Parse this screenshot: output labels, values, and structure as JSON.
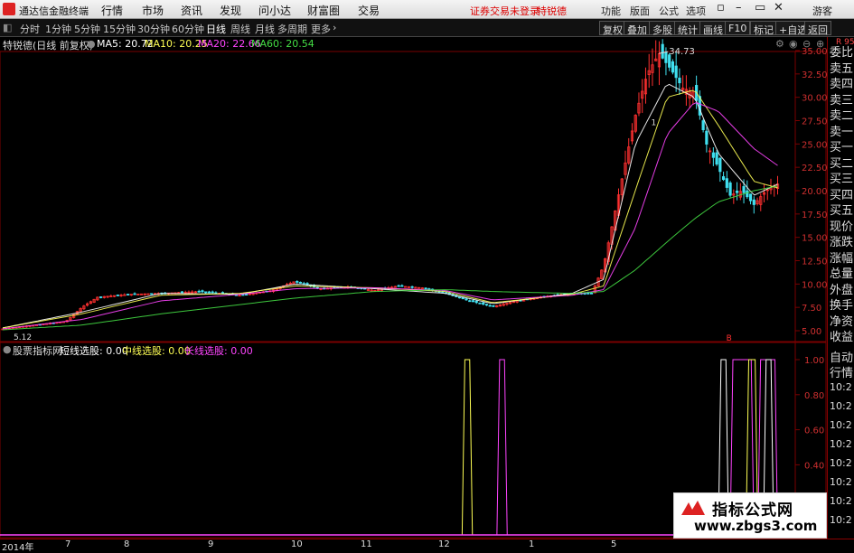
{
  "window": {
    "app_title": "通达信金融终端",
    "menu": [
      "行情",
      "市场",
      "资讯",
      "发现",
      "问小达",
      "财富圈",
      "交易"
    ],
    "status_notice": "证券交易未登录",
    "stock_name_title": "特锐德",
    "controls": [
      "功能",
      "版面",
      "公式",
      "选项"
    ],
    "guest": "游客"
  },
  "toolbar": {
    "periods": [
      "分时",
      "1分钟",
      "5分钟",
      "15分钟",
      "30分钟",
      "60分钟",
      "日线",
      "周线",
      "月线",
      "多周期",
      "更多"
    ],
    "active_period": "日线",
    "right_buttons": [
      "复权",
      "叠加",
      "多股",
      "统计",
      "画线",
      "F10",
      "标记",
      "+自选",
      "返回"
    ]
  },
  "main_chart": {
    "title": "特锐德(日线 前复权)",
    "ma": [
      {
        "label": "MA5: 20.72",
        "color": "#ffffff"
      },
      {
        "label": "MA10: 20.25",
        "color": "#ffff55"
      },
      {
        "label": "MA20: 22.66",
        "color": "#ff44ff"
      },
      {
        "label": "MA60: 20.54",
        "color": "#44dd44"
      }
    ],
    "high_label": "34.73",
    "low_label": "5.12",
    "marker_b": "B",
    "marker_1": "1"
  },
  "indicator": {
    "title": "股票指标网",
    "lines": [
      {
        "label": "短线选股: 0.00",
        "color": "#ffffff"
      },
      {
        "label": "中线选股: 0.00",
        "color": "#ffff55"
      },
      {
        "label": "长线选股: 0.00",
        "color": "#ff44ff"
      }
    ]
  },
  "side_panel": {
    "top_label": "R 95",
    "items": [
      "委比",
      "卖五",
      "卖四",
      "卖三",
      "卖二",
      "卖一",
      "买一",
      "买二",
      "买三",
      "买四",
      "买五",
      "现价",
      "涨跌",
      "涨幅",
      "总量",
      "外盘",
      "换手",
      "净资",
      "收益"
    ],
    "lower": [
      "自动",
      "行情"
    ],
    "times": [
      "10:2",
      "10:2",
      "10:2",
      "10:2",
      "10:2",
      "10:2",
      "10:2",
      "10:2"
    ]
  },
  "date_axis": {
    "labels": [
      "2014年",
      "7",
      "8",
      "9",
      "10",
      "11",
      "12",
      "1",
      "5"
    ]
  },
  "watermark": {
    "line1": "指标公式网",
    "line2": "www.zbgs3.com"
  },
  "chart_data": [
    {
      "type": "candlestick",
      "title": "特锐德(日线 前复权)",
      "ylim": [
        5.0,
        35.0
      ],
      "y_ticks": [
        35.0,
        32.5,
        30.0,
        27.5,
        25.0,
        22.5,
        20.0,
        17.5,
        15.0,
        12.5,
        10.0,
        7.5,
        5.0
      ],
      "ma_labels": [
        "MA5: 20.72",
        "MA10: 20.25",
        "MA20: 22.66",
        "MA60: 20.54"
      ],
      "price_path": [
        [
          0,
          5.2
        ],
        [
          0.04,
          5.6
        ],
        [
          0.08,
          6.0
        ],
        [
          0.1,
          7.5
        ],
        [
          0.12,
          8.6
        ],
        [
          0.16,
          8.9
        ],
        [
          0.2,
          9.0
        ],
        [
          0.25,
          9.2
        ],
        [
          0.3,
          8.8
        ],
        [
          0.34,
          9.3
        ],
        [
          0.37,
          10.3
        ],
        [
          0.4,
          9.5
        ],
        [
          0.44,
          9.7
        ],
        [
          0.47,
          9.3
        ],
        [
          0.5,
          9.8
        ],
        [
          0.53,
          9.6
        ],
        [
          0.56,
          9.0
        ],
        [
          0.59,
          8.2
        ],
        [
          0.62,
          7.6
        ],
        [
          0.65,
          8.2
        ],
        [
          0.68,
          8.6
        ],
        [
          0.72,
          9.0
        ],
        [
          0.745,
          9.0
        ],
        [
          0.76,
          12.0
        ],
        [
          0.78,
          20.0
        ],
        [
          0.8,
          28.0
        ],
        [
          0.815,
          32.5
        ],
        [
          0.83,
          34.7
        ],
        [
          0.845,
          33.0
        ],
        [
          0.86,
          31.0
        ],
        [
          0.875,
          30.5
        ],
        [
          0.89,
          25.0
        ],
        [
          0.905,
          22.5
        ],
        [
          0.92,
          19.5
        ],
        [
          0.935,
          20.0
        ],
        [
          0.95,
          18.5
        ],
        [
          0.965,
          20.0
        ],
        [
          0.98,
          20.7
        ]
      ],
      "ma5_path": [
        [
          0,
          5.3
        ],
        [
          0.1,
          7.0
        ],
        [
          0.2,
          9.0
        ],
        [
          0.3,
          8.9
        ],
        [
          0.37,
          10.0
        ],
        [
          0.47,
          9.5
        ],
        [
          0.56,
          9.0
        ],
        [
          0.62,
          7.9
        ],
        [
          0.72,
          9.0
        ],
        [
          0.76,
          10.5
        ],
        [
          0.8,
          25.0
        ],
        [
          0.84,
          31.5
        ],
        [
          0.875,
          30.0
        ],
        [
          0.905,
          24.0
        ],
        [
          0.95,
          19.5
        ],
        [
          0.98,
          20.7
        ]
      ],
      "ma10_path": [
        [
          0,
          5.3
        ],
        [
          0.1,
          6.8
        ],
        [
          0.2,
          8.8
        ],
        [
          0.3,
          9.0
        ],
        [
          0.37,
          9.8
        ],
        [
          0.47,
          9.6
        ],
        [
          0.56,
          9.2
        ],
        [
          0.62,
          8.0
        ],
        [
          0.72,
          8.9
        ],
        [
          0.76,
          9.8
        ],
        [
          0.8,
          20.0
        ],
        [
          0.84,
          30.0
        ],
        [
          0.875,
          30.8
        ],
        [
          0.905,
          27.0
        ],
        [
          0.95,
          21.0
        ],
        [
          0.98,
          20.3
        ]
      ],
      "ma20_path": [
        [
          0,
          5.2
        ],
        [
          0.1,
          6.2
        ],
        [
          0.2,
          8.2
        ],
        [
          0.3,
          8.9
        ],
        [
          0.37,
          9.5
        ],
        [
          0.47,
          9.6
        ],
        [
          0.56,
          9.3
        ],
        [
          0.62,
          8.3
        ],
        [
          0.72,
          8.8
        ],
        [
          0.76,
          9.4
        ],
        [
          0.8,
          16.0
        ],
        [
          0.84,
          26.0
        ],
        [
          0.875,
          29.5
        ],
        [
          0.905,
          28.5
        ],
        [
          0.95,
          24.5
        ],
        [
          0.98,
          22.7
        ]
      ],
      "ma60_path": [
        [
          0,
          5.1
        ],
        [
          0.1,
          5.6
        ],
        [
          0.2,
          6.8
        ],
        [
          0.3,
          7.8
        ],
        [
          0.37,
          8.5
        ],
        [
          0.47,
          9.2
        ],
        [
          0.56,
          9.4
        ],
        [
          0.62,
          9.2
        ],
        [
          0.72,
          9.0
        ],
        [
          0.76,
          9.2
        ],
        [
          0.8,
          11.5
        ],
        [
          0.84,
          14.5
        ],
        [
          0.875,
          17.0
        ],
        [
          0.905,
          18.8
        ],
        [
          0.95,
          20.0
        ],
        [
          0.98,
          20.5
        ]
      ]
    },
    {
      "type": "line",
      "title": "股票指标网",
      "ylim": [
        0.0,
        1.0
      ],
      "y_ticks": [
        1.0,
        0.8,
        0.6,
        0.4
      ],
      "series": [
        {
          "name": "短线选股",
          "values": "pulse"
        },
        {
          "name": "中线选股",
          "values": "pulse"
        },
        {
          "name": "长线选股",
          "values": "pulse"
        }
      ]
    }
  ]
}
